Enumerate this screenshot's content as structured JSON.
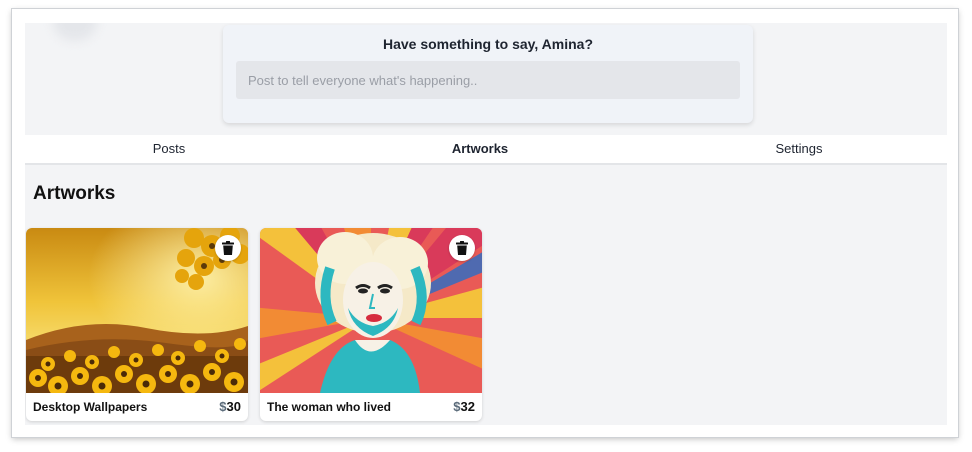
{
  "composer": {
    "title": "Have something to say, Amina?",
    "placeholder": "Post to tell everyone what's happening.."
  },
  "tabs": [
    {
      "label": "Posts",
      "active": false
    },
    {
      "label": "Artworks",
      "active": true
    },
    {
      "label": "Settings",
      "active": false
    }
  ],
  "section": {
    "title": "Artworks"
  },
  "artworks": [
    {
      "title": "Desktop Wallpapers",
      "currency": "$",
      "price": "30",
      "image": "sunflower-field-landscape"
    },
    {
      "title": "The woman who lived",
      "currency": "$",
      "price": "32",
      "image": "pop-art-woman-portrait"
    }
  ],
  "icons": {
    "delete": "trash-icon"
  },
  "colors": {
    "background": "#f3f4f6",
    "composer_bg": "#f0f3f8",
    "input_bg": "#e4e6ea"
  }
}
